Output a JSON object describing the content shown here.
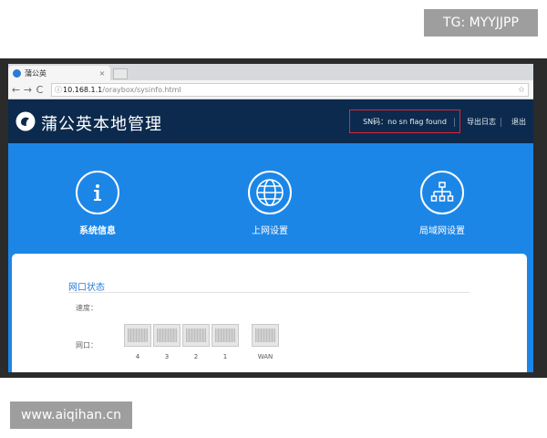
{
  "watermarks": {
    "top": "TG: MYYJJPP",
    "bottom": "www.aiqihan.cn"
  },
  "browser": {
    "tab_title": "蒲公英",
    "tab_close": "×",
    "nav": {
      "back": "←",
      "forward": "→",
      "reload": "C"
    },
    "address": {
      "host": "10.168.1.1",
      "path": "/oraybox/sysinfo.html"
    },
    "star": "☆"
  },
  "app": {
    "brand": "蒲公英本地管理",
    "sn_text": "SN码：no sn flag found",
    "export_log": "导出日志",
    "logout": "退出",
    "colors": {
      "header": "#0c2a4d",
      "accent": "#1c86e6",
      "highlight": "#e22434"
    }
  },
  "features": [
    {
      "label": "系统信息",
      "icon": "info-icon"
    },
    {
      "label": "上网设置",
      "icon": "globe-icon"
    },
    {
      "label": "局域网设置",
      "icon": "network-icon"
    }
  ],
  "panel": {
    "section_title": "网口状态",
    "speed_label": "速度：",
    "port_label": "网口：",
    "ports": [
      "4",
      "3",
      "2",
      "1",
      "WAN"
    ]
  }
}
